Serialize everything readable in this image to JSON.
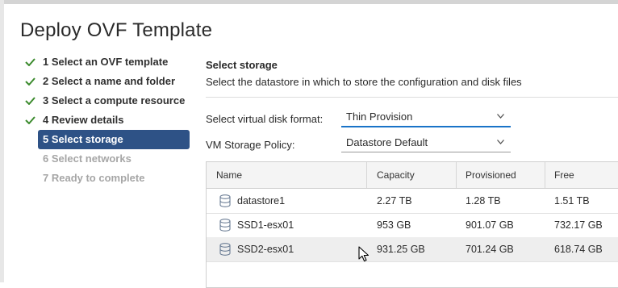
{
  "dialog": {
    "title": "Deploy OVF Template"
  },
  "steps": [
    {
      "label": "1 Select an OVF template",
      "state": "done"
    },
    {
      "label": "2 Select a name and folder",
      "state": "done"
    },
    {
      "label": "3 Select a compute resource",
      "state": "done"
    },
    {
      "label": "4 Review details",
      "state": "done"
    },
    {
      "label": "5 Select storage",
      "state": "active"
    },
    {
      "label": "6 Select networks",
      "state": "disabled"
    },
    {
      "label": "7 Ready to complete",
      "state": "disabled"
    }
  ],
  "storage": {
    "title": "Select storage",
    "description": "Select the datastore in which to store the configuration and disk files",
    "disk_format_label": "Select virtual disk format:",
    "disk_format_value": "Thin Provision",
    "policy_label": "VM Storage Policy:",
    "policy_value": "Datastore Default"
  },
  "table": {
    "columns": [
      "Name",
      "Capacity",
      "Provisioned",
      "Free"
    ],
    "rows": [
      {
        "name": "datastore1",
        "capacity": "2.27 TB",
        "provisioned": "1.28 TB",
        "free": "1.51 TB"
      },
      {
        "name": "SSD1-esx01",
        "capacity": "953 GB",
        "provisioned": "901.07 GB",
        "free": "732.17 GB"
      },
      {
        "name": "SSD2-esx01",
        "capacity": "931.25 GB",
        "provisioned": "701.24 GB",
        "free": "618.74 GB"
      }
    ]
  },
  "colors": {
    "accent": "#2e5286",
    "check": "#3c8b2e",
    "focus": "#1a73c8"
  },
  "icons": {
    "done": "checkmark-icon",
    "datastore": "database-icon",
    "dropdown": "chevron-down-icon",
    "pointer": "mouse-cursor-icon"
  }
}
